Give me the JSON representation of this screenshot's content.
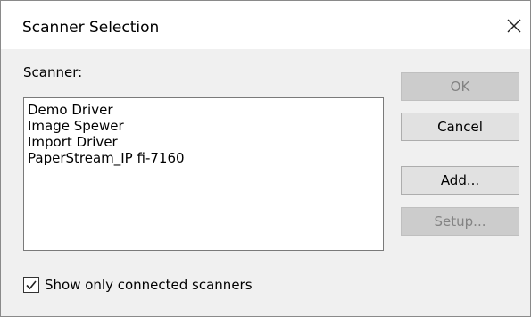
{
  "window": {
    "title": "Scanner Selection",
    "close_icon": "close-icon"
  },
  "scanner_list": {
    "label": "Scanner:",
    "items": [
      "Demo Driver",
      "Image Spewer",
      "Import Driver",
      "PaperStream_IP fi-7160"
    ]
  },
  "buttons": {
    "ok": {
      "label": "OK",
      "enabled": false
    },
    "cancel": {
      "label": "Cancel",
      "enabled": true
    },
    "add": {
      "label": "Add...",
      "enabled": true
    },
    "setup": {
      "label": "Setup...",
      "enabled": false
    }
  },
  "filter": {
    "show_connected_label": "Show only connected scanners",
    "checked": true,
    "check_icon": "checkmark-icon"
  },
  "colors": {
    "dialog_bg": "#f0f0f0",
    "titlebar_bg": "#ffffff",
    "button_bg": "#e1e1e1",
    "button_disabled_bg": "#cccccc",
    "button_disabled_text": "#838383"
  }
}
